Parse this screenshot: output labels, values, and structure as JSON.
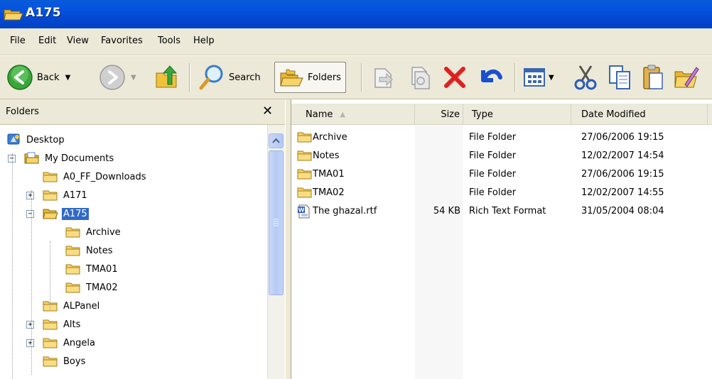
{
  "window": {
    "title": "A175"
  },
  "menu": [
    "File",
    "Edit",
    "View",
    "Favorites",
    "Tools",
    "Help"
  ],
  "toolbar": {
    "back_label": "Back",
    "search_label": "Search",
    "folders_label": "Folders",
    "icons": [
      "back-arrow-icon",
      "forward-arrow-icon",
      "up-folder-icon",
      "search-icon",
      "folders-icon",
      "move-to-icon",
      "copy-to-icon",
      "delete-icon",
      "undo-icon",
      "views-icon",
      "cut-icon",
      "copy-icon",
      "paste-icon",
      "properties-icon"
    ]
  },
  "folders_pane": {
    "title": "Folders",
    "close": "✕",
    "tree": [
      {
        "label": "Desktop",
        "level": 0,
        "icon": "desktop-icon",
        "expander": "",
        "selected": false
      },
      {
        "label": "My Documents",
        "level": 1,
        "icon": "my-documents-icon",
        "expander": "−",
        "selected": false
      },
      {
        "label": "A0_FF_Downloads",
        "level": 2,
        "icon": "folder-icon",
        "expander": "",
        "selected": false
      },
      {
        "label": "A171",
        "level": 2,
        "icon": "folder-icon",
        "expander": "+",
        "selected": false
      },
      {
        "label": "A175",
        "level": 2,
        "icon": "open-folder-icon",
        "expander": "−",
        "selected": true
      },
      {
        "label": "Archive",
        "level": 3,
        "icon": "folder-icon",
        "expander": "",
        "selected": false
      },
      {
        "label": "Notes",
        "level": 3,
        "icon": "folder-icon",
        "expander": "",
        "selected": false
      },
      {
        "label": "TMA01",
        "level": 3,
        "icon": "folder-icon",
        "expander": "",
        "selected": false
      },
      {
        "label": "TMA02",
        "level": 3,
        "icon": "folder-icon",
        "expander": "",
        "selected": false
      },
      {
        "label": "ALPanel",
        "level": 2,
        "icon": "folder-icon",
        "expander": "",
        "selected": false
      },
      {
        "label": "Alts",
        "level": 2,
        "icon": "folder-icon",
        "expander": "+",
        "selected": false
      },
      {
        "label": "Angela",
        "level": 2,
        "icon": "folder-icon",
        "expander": "+",
        "selected": false
      },
      {
        "label": "Boys",
        "level": 2,
        "icon": "folder-icon",
        "expander": "",
        "selected": false
      }
    ]
  },
  "file_list": {
    "columns": {
      "name": "Name",
      "size": "Size",
      "type": "Type",
      "date": "Date Modified"
    },
    "sort_indicator": "▲",
    "rows": [
      {
        "name": "Archive",
        "size": "",
        "type": "File Folder",
        "date": "27/06/2006 19:15",
        "icon": "folder-icon"
      },
      {
        "name": "Notes",
        "size": "",
        "type": "File Folder",
        "date": "12/02/2007 14:54",
        "icon": "folder-icon"
      },
      {
        "name": "TMA01",
        "size": "",
        "type": "File Folder",
        "date": "27/06/2006 19:15",
        "icon": "folder-icon"
      },
      {
        "name": "TMA02",
        "size": "",
        "type": "File Folder",
        "date": "12/02/2007 14:55",
        "icon": "folder-icon"
      },
      {
        "name": "The ghazal.rtf",
        "size": "54 KB",
        "type": "Rich Text Format",
        "date": "31/05/2004 08:04",
        "icon": "word-document-icon"
      }
    ]
  },
  "colors": {
    "title_bar": "#0554e0",
    "selection": "#316ac5",
    "chrome": "#ece9d8",
    "folder": "#f5d36b"
  }
}
